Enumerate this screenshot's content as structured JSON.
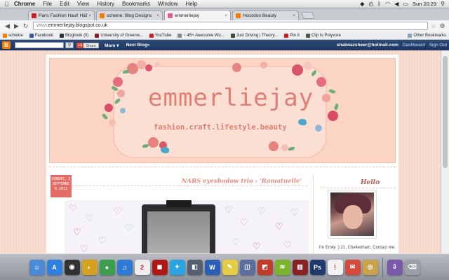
{
  "menubar": {
    "app": "Chrome",
    "items": [
      "File",
      "Edit",
      "View",
      "History",
      "Bookmarks",
      "Window",
      "Help"
    ],
    "clock": "Sun 20:29"
  },
  "tabs": [
    {
      "title": "Paris Fashion Haul! H&M, Za",
      "favicon_color": "#cc2222"
    },
    {
      "title": "scheine: Blog Designs",
      "favicon_color": "#f57d00"
    },
    {
      "title": "emmerliejay",
      "favicon_color": "#e35d8a"
    },
    {
      "title": "Hoozdoo Beauty",
      "favicon_color": "#f57d00"
    }
  ],
  "address": {
    "url_prefix": "www.",
    "url": "emmerliejay.blogspot.co.uk"
  },
  "bookmarks": [
    {
      "label": "scheine",
      "color": "#f57d00"
    },
    {
      "label": "Facebook",
      "color": "#3b5998"
    },
    {
      "label": "Bloglovin (0)",
      "color": "#333333"
    },
    {
      "label": "University of Greenw...",
      "color": "#8a1c2b"
    },
    {
      "label": "YouTube",
      "color": "#cc2222"
    },
    {
      "label": "~ 45+ Awesome Wo...",
      "color": "#888888"
    },
    {
      "label": "Just Driving | Theory...",
      "color": "#444444"
    },
    {
      "label": "Pin It",
      "color": "#cb2027"
    },
    {
      "label": "Clip to Polyvore",
      "color": "#555555"
    }
  ],
  "bookmarks_other": "Other Bookmarks",
  "blogger_nav": {
    "logo": "B",
    "gplus": "+1",
    "share": "Share",
    "more": "More ▾",
    "next_blog": "Next Blog»",
    "email": "shabnazsheer@hotmail.com",
    "dashboard": "Dashboard",
    "signout": "Sign Out"
  },
  "blog": {
    "title": "emmerliejay",
    "tagline": "fashion.craft.lifestyle.beauty"
  },
  "post": {
    "date_lines": [
      "SUNDAY, 2",
      "SEPTEMBE",
      "R 2012"
    ],
    "title": "NARS eyeshadow trio - 'Ramatuelle'"
  },
  "sidebar": {
    "heading": "Hello",
    "about": "I'm Emily :) 21, Cheltenham. Contact me:"
  },
  "colors": {
    "accent": "#e36d66",
    "blog_title": "#e07e74",
    "page_bg": "#f9dacd"
  },
  "dock_icons": [
    {
      "name": "finder-icon",
      "glyph": "☺",
      "color": "#4a8ad6"
    },
    {
      "name": "app-store-icon",
      "glyph": "A",
      "color": "#2f7fe0"
    },
    {
      "name": "dashboard-icon",
      "glyph": "◉",
      "color": "#333333"
    },
    {
      "name": "iphoto-icon",
      "glyph": "◐",
      "color": "#d6a020"
    },
    {
      "name": "chrome-icon",
      "glyph": "●",
      "color": "#3b9e4f"
    },
    {
      "name": "itunes-icon",
      "glyph": "♫",
      "color": "#2b7bd6"
    },
    {
      "name": "calendar-icon",
      "glyph": "2",
      "color": "#eeeeee"
    },
    {
      "name": "photo-booth-icon",
      "glyph": "◼",
      "color": "#b01818"
    },
    {
      "name": "twitter-icon",
      "glyph": "✦",
      "color": "#2aa3e0"
    },
    {
      "name": "preview-icon",
      "glyph": "◧",
      "color": "#556070"
    },
    {
      "name": "word-icon",
      "glyph": "W",
      "color": "#2b5fb5"
    },
    {
      "name": "stickies-icon",
      "glyph": "✎",
      "color": "#e5cc45"
    },
    {
      "name": "image-capture-icon",
      "glyph": "◫",
      "color": "#5a6fa0"
    },
    {
      "name": "remote-icon",
      "glyph": "◩",
      "color": "#c23a2a"
    },
    {
      "name": "spotify-icon",
      "glyph": "≋",
      "color": "#7ab52d"
    },
    {
      "name": "books-icon",
      "glyph": "▥",
      "color": "#8b2222"
    },
    {
      "name": "photoshop-icon",
      "glyph": "Ps",
      "color": "#1e3a6e"
    },
    {
      "name": "idea-icon",
      "glyph": "!",
      "color": "#f2f2f2"
    },
    {
      "name": "mail-icon",
      "glyph": "✉",
      "color": "#d44a3a"
    },
    {
      "name": "rings-icon",
      "glyph": "◎",
      "color": "#c9a24a"
    },
    {
      "name": "downloads-icon",
      "glyph": "⇩",
      "color": "#7a5aa8"
    },
    {
      "name": "trash-icon",
      "glyph": "⌫",
      "color": "#9aa0a8"
    }
  ]
}
